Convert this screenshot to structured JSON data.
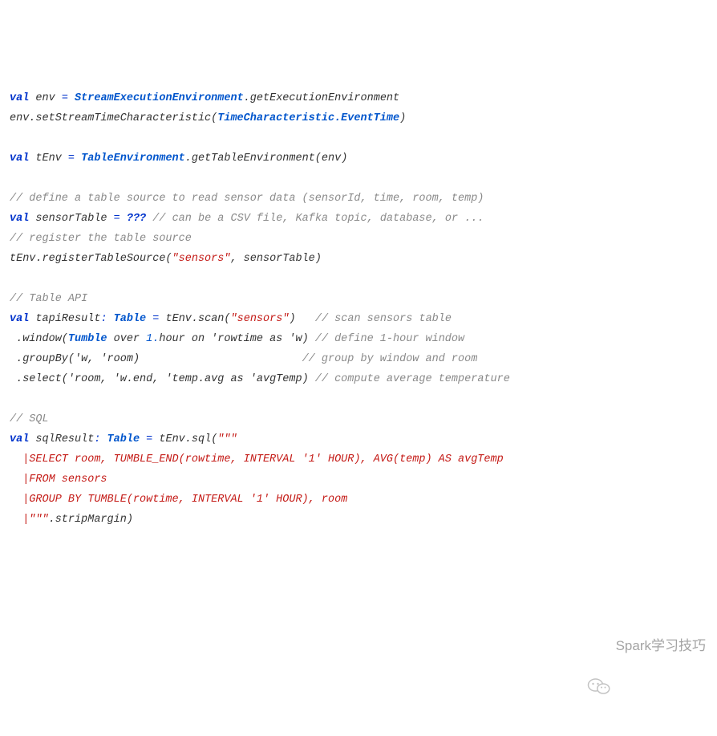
{
  "code": {
    "l1": {
      "kw": "val",
      "id": " env ",
      "op": "=",
      "sp": " ",
      "t1": "StreamExecutionEnvironment",
      "dot": ".",
      "m": "getExecutionEnvironment"
    },
    "l2": {
      "a": "env.setStreamTimeCharacteristic(",
      "t": "TimeCharacteristic.EventTime",
      "b": ")"
    },
    "l3": "",
    "l4": {
      "kw": "val",
      "id": " tEnv ",
      "op": "=",
      "sp": " ",
      "t": "TableEnvironment",
      "rest": ".getTableEnvironment(env)"
    },
    "l5": "",
    "l6": {
      "com": "// define a table source to read sensor data (sensorId, time, room, temp)"
    },
    "l7": {
      "kw": "val",
      "id": " sensorTable ",
      "op": "=",
      "sp": " ",
      "q": "???",
      "sp2": " ",
      "com": "// can be a CSV file, Kafka topic, database, or ..."
    },
    "l8": {
      "com": "// register the table source"
    },
    "l9": {
      "a": "tEnv.registerTableSource(",
      "s": "\"sensors\"",
      "b": ", sensorTable)"
    },
    "l10": "",
    "l11": {
      "com": "// Table API"
    },
    "l12": {
      "kw": "val",
      "id": " tapiResult",
      "op": ":",
      "sp": " ",
      "t": "Table",
      "sp2": " ",
      "op2": "=",
      "rest": " tEnv.scan(",
      "s": "\"sensors\"",
      "rest2": ")   ",
      "com": "// scan sensors table"
    },
    "l13": {
      "a": " .window(",
      "t": "Tumble",
      "b": " over ",
      "n": "1.",
      "c": "hour on ",
      "sym": "'rowtime as 'w",
      "d": ") ",
      "com": "// define 1-hour window"
    },
    "l14": {
      "a": " .groupBy(",
      "sym": "'w, 'room",
      "b": ")                         ",
      "com": "// group by window and room"
    },
    "l15": {
      "a": " .select(",
      "sym": "'room, 'w.end, 'temp.avg as 'avgTemp",
      "b": ") ",
      "com": "// compute average temperature"
    },
    "l16": "",
    "l17": {
      "com": "// SQL"
    },
    "l18": {
      "kw": "val",
      "id": " sqlResult",
      "op": ":",
      "sp": " ",
      "t": "Table",
      "sp2": " ",
      "op2": "=",
      "rest": " tEnv.sql(",
      "s": "\"\"\""
    },
    "l19": {
      "s": "  |SELECT room, TUMBLE_END(rowtime, INTERVAL '1' HOUR), AVG(temp) AS avgTemp"
    },
    "l20": {
      "s": "  |FROM sensors"
    },
    "l21": {
      "s": "  |GROUP BY TUMBLE(rowtime, INTERVAL '1' HOUR), room"
    },
    "l22": {
      "s": "  |\"\"\"",
      "rest": ".stripMargin)"
    }
  },
  "watermark": {
    "text": "Spark学习技巧"
  }
}
